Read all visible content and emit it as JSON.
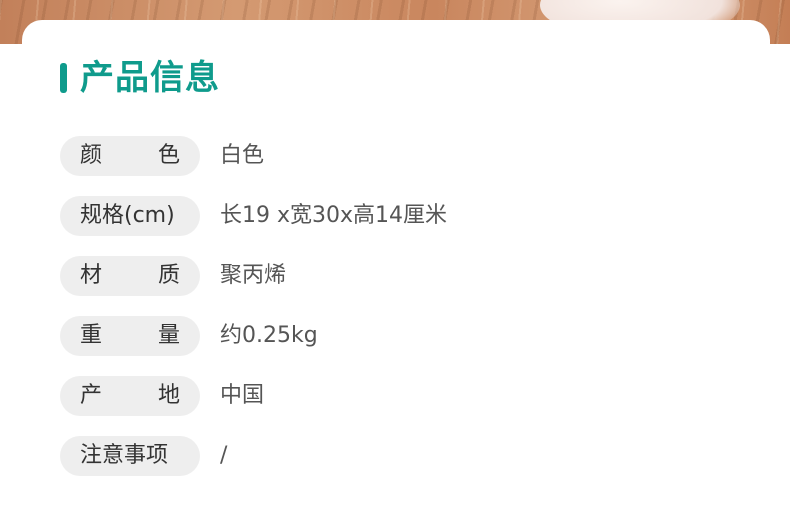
{
  "colors": {
    "accent": "#0f9b8c",
    "label_background": "#eeeeee",
    "label_text": "#333333",
    "value_text": "#555555"
  },
  "section": {
    "title": "产品信息"
  },
  "rows": [
    {
      "label_chars": [
        "颜",
        "色"
      ],
      "value": "白色"
    },
    {
      "label": "规格(cm)",
      "value": "长19 x宽30x高14厘米"
    },
    {
      "label_chars": [
        "材",
        "质"
      ],
      "value": "聚丙烯"
    },
    {
      "label_chars": [
        "重",
        "量"
      ],
      "value": "约0.25kg"
    },
    {
      "label_chars": [
        "产",
        "地"
      ],
      "value": "中国"
    },
    {
      "label": "注意事项",
      "value": "/"
    }
  ]
}
